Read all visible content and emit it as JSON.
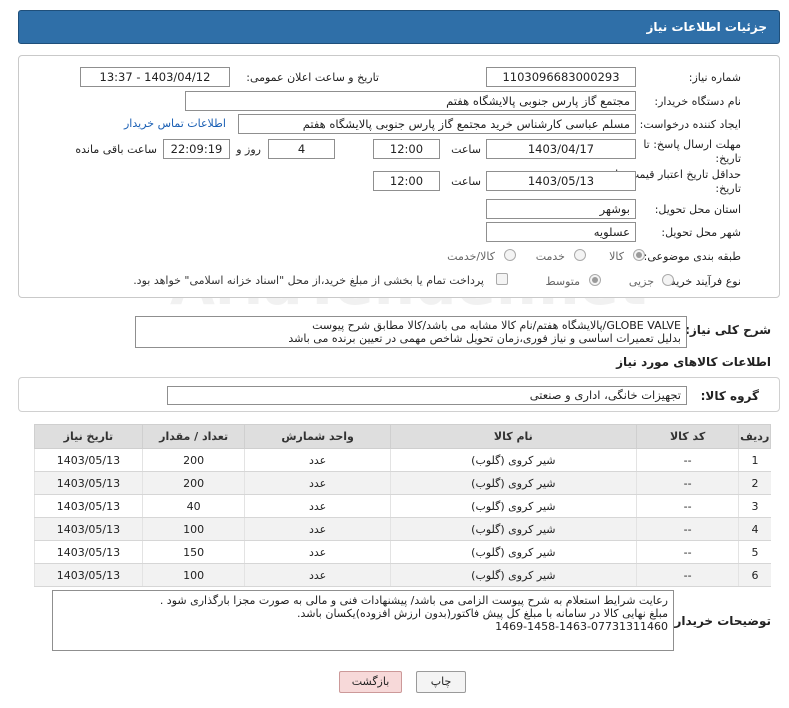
{
  "header": {
    "title": "جزئیات اطلاعات نیاز"
  },
  "form": {
    "need_number_label": "شماره نیاز:",
    "need_number": "1103096683000293",
    "announce_label": "تاریخ و ساعت اعلان عمومی:",
    "announce_value": "1403/04/12 - 13:37",
    "buyer_org_label": "نام دستگاه خریدار:",
    "buyer_org": "مجتمع گاز پارس جنوبی  پالایشگاه هفتم",
    "requester_label": "ایجاد کننده درخواست:",
    "requester": "مسلم عباسی کارشناس خرید مجتمع گاز پارس جنوبی  پالایشگاه هفتم",
    "contact_link": "اطلاعات تماس خریدار",
    "deadline_label_1": "مهلت ارسال پاسخ: تا",
    "deadline_label_2": "تاریخ:",
    "deadline_date": "1403/04/17",
    "time_label": "ساعت",
    "deadline_time": "12:00",
    "days_value": "4",
    "days_label": "روز و",
    "remaining_time": "22:09:19",
    "remaining_label": "ساعت باقی مانده",
    "validity_label_1": "حداقل تاریخ اعتبار قیمت: تا",
    "validity_label_2": "تاریخ:",
    "validity_date": "1403/05/13",
    "validity_time_label": "ساعت",
    "validity_time": "12:00",
    "province_label": "استان محل تحویل:",
    "province": "بوشهر",
    "city_label": "شهر محل تحویل:",
    "city": "عسلویه",
    "category_label": "طبقه بندی موضوعی:",
    "category_options": [
      "کالا",
      "خدمت",
      "کالا/خدمت"
    ],
    "process_label": "نوع فرآیند خرید :",
    "process_options": [
      "جزیی",
      "متوسط"
    ],
    "treasury_note": "پرداخت تمام یا بخشی از مبلغ خرید،از محل \"اسناد خزانه اسلامی\" خواهد بود."
  },
  "description": {
    "label": "شرح کلی نیاز:",
    "line1": "GLOBE VALVE/پالایشگاه هفتم/نام کالا مشابه می باشد/کالا مطابق شرح پیوست",
    "line2": "بدلیل تعمیرات اساسی و نیاز فوری،زمان تحویل شاخص مهمی در تعیین برنده می باشد"
  },
  "goods_section": {
    "title": "اطلاعات کالاهای مورد نیاز",
    "group_label": "گروه کالا:",
    "group_value": "تجهیزات خانگی، اداری و صنعتی"
  },
  "table": {
    "headers": [
      "ردیف",
      "کد کالا",
      "نام کالا",
      "واحد شمارش",
      "تعداد / مقدار",
      "تاریخ نیاز"
    ],
    "rows": [
      [
        "1",
        "--",
        "شیر کروی (گلوب)",
        "عدد",
        "200",
        "1403/05/13"
      ],
      [
        "2",
        "--",
        "شیر کروی (گلوب)",
        "عدد",
        "200",
        "1403/05/13"
      ],
      [
        "3",
        "--",
        "شیر کروی (گلوب)",
        "عدد",
        "40",
        "1403/05/13"
      ],
      [
        "4",
        "--",
        "شیر کروی (گلوب)",
        "عدد",
        "100",
        "1403/05/13"
      ],
      [
        "5",
        "--",
        "شیر کروی (گلوب)",
        "عدد",
        "150",
        "1403/05/13"
      ],
      [
        "6",
        "--",
        "شیر کروی (گلوب)",
        "عدد",
        "100",
        "1403/05/13"
      ]
    ]
  },
  "buyer_notes": {
    "label": "توضیحات خریدار:",
    "line1": "رعایت شرایط استعلام به شرح پیوست الزامی می باشد/ پیشنهادات فنی و مالی به صورت مجزا بارگذاری شود .",
    "line2": "مبلغ نهایی کالا در سامانه با مبلغ کل پیش فاکتور(بدون ارزش افزوده)یکسان باشد.",
    "line3": "1469-1458-1463-07731311460"
  },
  "buttons": {
    "print": "چاپ",
    "back": "بازگشت"
  },
  "watermark": "AriaTender.net"
}
